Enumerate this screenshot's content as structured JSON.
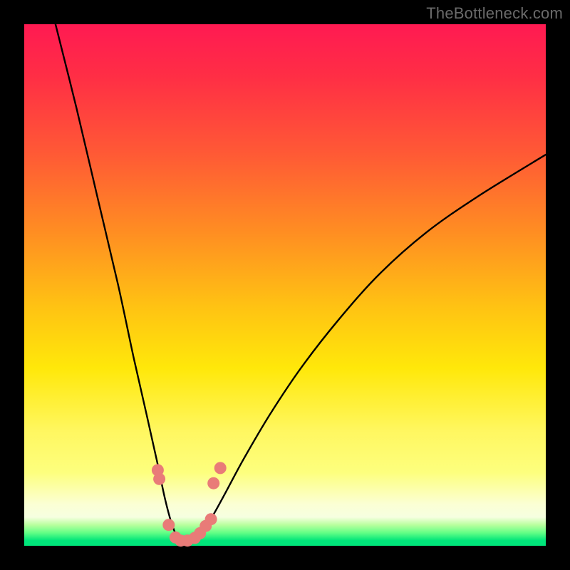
{
  "watermark": "TheBottleneck.com",
  "chart_data": {
    "type": "line",
    "title": "",
    "xlabel": "",
    "ylabel": "",
    "xlim": [
      0,
      100
    ],
    "ylim": [
      0,
      100
    ],
    "series": [
      {
        "name": "bottleneck-curve",
        "x": [
          6,
          10,
          14,
          18,
          21,
          23.5,
          25.5,
          27,
          28.2,
          29.2,
          30.2,
          31.2,
          32.5,
          34,
          36,
          38.5,
          42,
          47,
          53,
          60,
          68,
          77,
          87,
          100
        ],
        "values": [
          100,
          84,
          67,
          50,
          36,
          25,
          16,
          9,
          4.5,
          2,
          1,
          1,
          1.4,
          2.6,
          5.5,
          10,
          16.5,
          25,
          34,
          43,
          52,
          60,
          67,
          75
        ]
      }
    ],
    "markers": {
      "name": "highlight-dots",
      "color": "#e97b78",
      "points": [
        {
          "x": 25.6,
          "y": 14.5
        },
        {
          "x": 25.9,
          "y": 12.8
        },
        {
          "x": 27.7,
          "y": 4.0
        },
        {
          "x": 29.0,
          "y": 1.6
        },
        {
          "x": 30.0,
          "y": 1.0
        },
        {
          "x": 31.3,
          "y": 1.0
        },
        {
          "x": 32.7,
          "y": 1.5
        },
        {
          "x": 33.7,
          "y": 2.4
        },
        {
          "x": 34.8,
          "y": 3.8
        },
        {
          "x": 35.8,
          "y": 5.1
        },
        {
          "x": 36.3,
          "y": 12.0
        },
        {
          "x": 37.6,
          "y": 14.9
        }
      ]
    }
  }
}
